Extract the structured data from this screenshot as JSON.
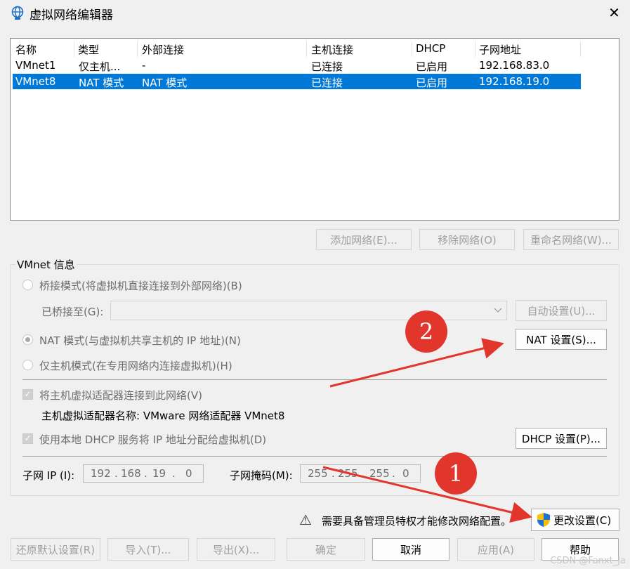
{
  "window": {
    "title": "虚拟网络编辑器",
    "close_glyph": "✕"
  },
  "list": {
    "columns": [
      "名称",
      "类型",
      "外部连接",
      "主机连接",
      "DHCP",
      "子网地址"
    ],
    "rows": [
      {
        "name": "VMnet1",
        "type": "仅主机...",
        "external": "-",
        "host": "已连接",
        "dhcp": "已启用",
        "subnet": "192.168.83.0",
        "selected": false
      },
      {
        "name": "VMnet8",
        "type": "NAT 模式",
        "external": "NAT 模式",
        "host": "已连接",
        "dhcp": "已启用",
        "subnet": "192.168.19.0",
        "selected": true
      }
    ]
  },
  "list_buttons": {
    "add": "添加网络(E)...",
    "remove": "移除网络(O)",
    "rename": "重命名网络(W)..."
  },
  "vmnet_info": {
    "label": "VMnet 信息",
    "bridge": "桥接模式(将虚拟机直接连接到外部网络)(B)",
    "bridged_to": "已桥接至(G):",
    "auto_settings": "自动设置(U)...",
    "nat": "NAT 模式(与虚拟机共享主机的 IP 地址)(N)",
    "nat_settings": "NAT 设置(S)...",
    "host_only": "仅主机模式(在专用网络内连接虚拟机)(H)",
    "connect_adapter": "将主机虚拟适配器连接到此网络(V)",
    "adapter_name": "主机虚拟适配器名称: VMware 网络适配器 VMnet8",
    "use_dhcp": "使用本地 DHCP 服务将 IP 地址分配给虚拟机(D)",
    "dhcp_settings": "DHCP 设置(P)...",
    "subnet_ip_label": "子网 IP (I):",
    "subnet_ip": [
      "192",
      "168",
      "19",
      "0"
    ],
    "subnet_mask_label": "子网掩码(M):",
    "subnet_mask": [
      "255",
      "255",
      "255",
      "0"
    ],
    "dot": "."
  },
  "admin": {
    "warning": "需要具备管理员特权才能修改网络配置。",
    "change_settings": "更改设置(C)",
    "warning_glyph": "⚠"
  },
  "footer": {
    "restore": "还原默认设置(R)",
    "import": "导入(T)...",
    "export": "导出(X)...",
    "ok": "确定",
    "cancel": "取消",
    "apply": "应用(A)",
    "help": "帮助"
  },
  "annotations": {
    "badge1": "1",
    "badge2": "2",
    "arrow_color": "#e2352b"
  },
  "watermark": "CSDN @Fanxt_Ja"
}
